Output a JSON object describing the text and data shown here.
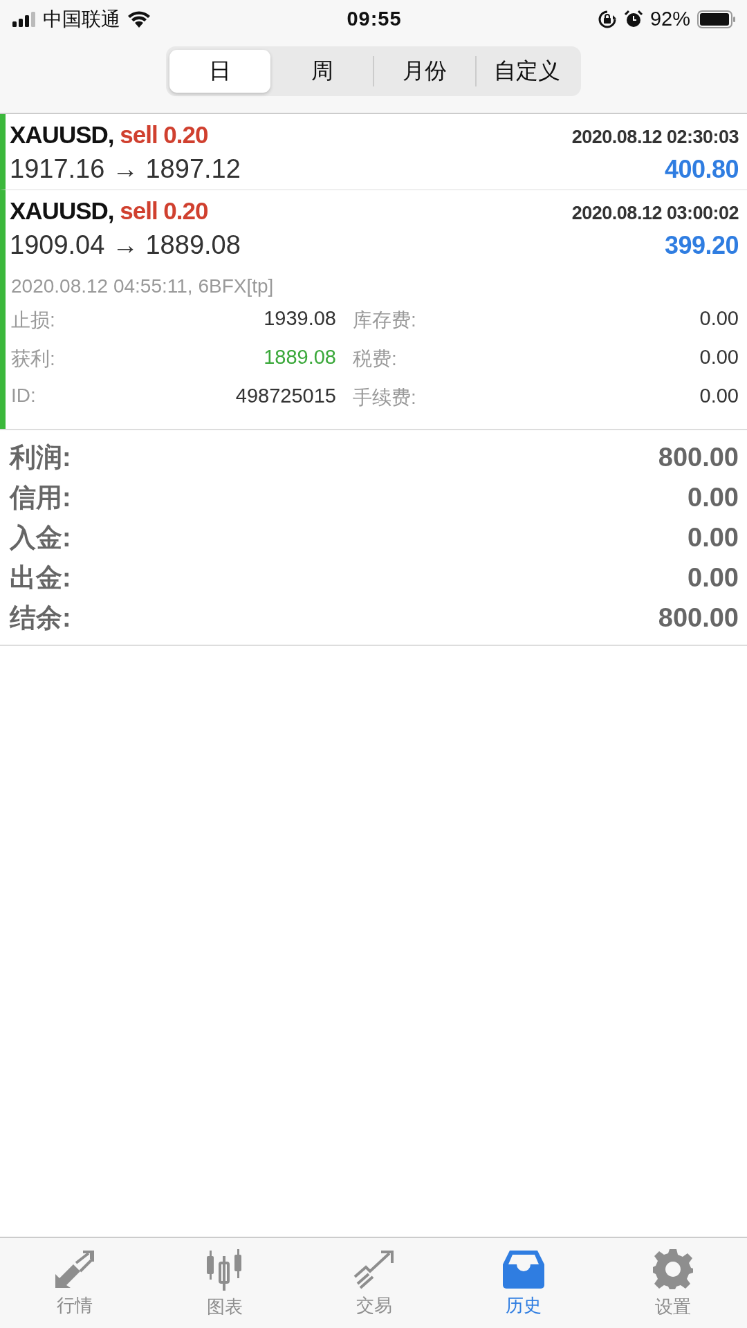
{
  "status_bar": {
    "carrier": "中国联通",
    "time": "09:55",
    "battery": "92%"
  },
  "tabs": [
    {
      "label": "日",
      "selected": true
    },
    {
      "label": "周",
      "selected": false
    },
    {
      "label": "月份",
      "selected": false
    },
    {
      "label": "自定义",
      "selected": false
    }
  ],
  "trades": [
    {
      "symbol": "XAUUSD,",
      "side": "sell 0.20",
      "time": "2020.08.12 02:30:03",
      "prices": "1917.16 → 1897.12",
      "profit": "400.80",
      "expanded": false
    },
    {
      "symbol": "XAUUSD,",
      "side": "sell 0.20",
      "time": "2020.08.12 03:00:02",
      "prices": "1909.04 → 1889.08",
      "profit": "399.20",
      "expanded": true,
      "comment": "2020.08.12 04:55:11, 6BFX[tp]",
      "details": [
        {
          "label": "止损:",
          "value": "1939.08",
          "highlighted": false
        },
        {
          "label": "库存费:",
          "value": "0.00",
          "highlighted": false
        },
        {
          "label": "获利:",
          "value": "1889.08",
          "highlighted": true
        },
        {
          "label": "税费:",
          "value": "0.00",
          "highlighted": false
        },
        {
          "label": "ID:",
          "value": "498725015",
          "highlighted": false
        },
        {
          "label": "手续费:",
          "value": "0.00",
          "highlighted": false
        }
      ]
    }
  ],
  "summary": [
    {
      "label": "利润:",
      "value": "800.00"
    },
    {
      "label": "信用:",
      "value": "0.00"
    },
    {
      "label": "入金:",
      "value": "0.00"
    },
    {
      "label": "出金:",
      "value": "0.00"
    },
    {
      "label": "结余:",
      "value": "800.00"
    }
  ],
  "nav": [
    {
      "label": "行情",
      "selected": false
    },
    {
      "label": "图表",
      "selected": false
    },
    {
      "label": "交易",
      "selected": false
    },
    {
      "label": "历史",
      "selected": true
    },
    {
      "label": "设置",
      "selected": false
    }
  ]
}
